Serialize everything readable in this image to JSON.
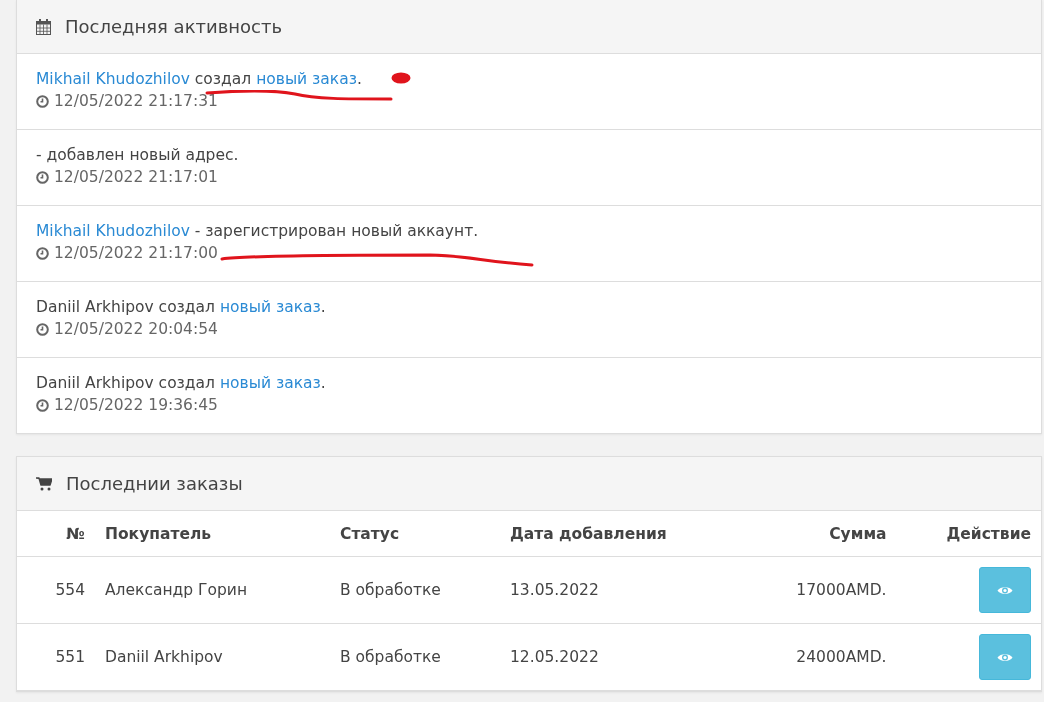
{
  "activity": {
    "title": "Последняя активность",
    "items": [
      {
        "parts": [
          {
            "kind": "link",
            "text": "Mikhail Khudozhilov"
          },
          {
            "kind": "text",
            "text": " создал "
          },
          {
            "kind": "link",
            "text": "новый заказ"
          },
          {
            "kind": "text",
            "text": "."
          }
        ],
        "time": "12/05/2022 21:17:31",
        "underlined": true,
        "dotted": true
      },
      {
        "parts": [
          {
            "kind": "text",
            "text": "- добавлен новый адрес."
          }
        ],
        "time": "12/05/2022 21:17:01"
      },
      {
        "parts": [
          {
            "kind": "link",
            "text": "Mikhail Khudozhilov"
          },
          {
            "kind": "text",
            "text": " - зарегистрирован новый аккаунт."
          }
        ],
        "time": "12/05/2022 21:17:00",
        "underlined": true
      },
      {
        "parts": [
          {
            "kind": "text",
            "text": "Daniil Arkhipov создал "
          },
          {
            "kind": "link",
            "text": "новый заказ"
          },
          {
            "kind": "text",
            "text": "."
          }
        ],
        "time": "12/05/2022 20:04:54"
      },
      {
        "parts": [
          {
            "kind": "text",
            "text": "Daniil Arkhipov создал "
          },
          {
            "kind": "link",
            "text": "новый заказ"
          },
          {
            "kind": "text",
            "text": "."
          }
        ],
        "time": "12/05/2022 19:36:45"
      }
    ]
  },
  "orders": {
    "title": "Последнии заказы",
    "columns": [
      "№",
      "Покупатель",
      "Статус",
      "Дата добавления",
      "Сумма",
      "Действие"
    ],
    "rows": [
      {
        "cells": [
          "554",
          "Александр Горин",
          "В обработке",
          "13.05.2022",
          "17000AMD."
        ]
      },
      {
        "cells": [
          "551",
          "Daniil Arkhipov",
          "В обработке",
          "12.05.2022",
          "24000AMD."
        ]
      }
    ]
  }
}
